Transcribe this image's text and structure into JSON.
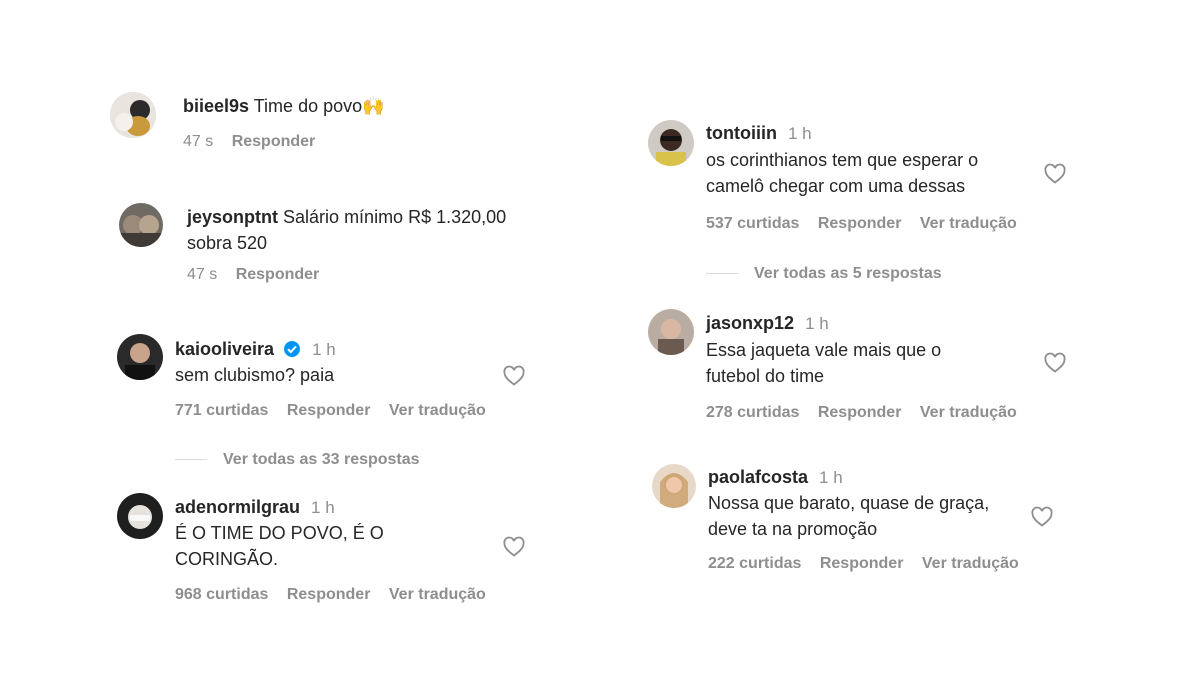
{
  "comments": [
    {
      "username": "biieel9s",
      "text": "Time do povo🙌",
      "time": "",
      "age": "47 s",
      "reply": "Responder",
      "likes": "",
      "translate": ""
    },
    {
      "username": "jeysonptnt",
      "text": "Salário mínimo R$ 1.320,00",
      "text2": "sobra 520",
      "time": "",
      "age": "47 s",
      "reply": "Responder"
    },
    {
      "username": "kaiooliveira",
      "verified": true,
      "time": "1 h",
      "text": "sem clubismo? paia",
      "likes": "771 curtidas",
      "reply": "Responder",
      "translate": "Ver tradução",
      "view_replies": "Ver todas as 33 respostas"
    },
    {
      "username": "adenormilgrau",
      "time": "1 h",
      "text": "É O TIME DO POVO, É O",
      "text2": "CORINGÃO.",
      "likes": "968 curtidas",
      "reply": "Responder",
      "translate": "Ver tradução"
    },
    {
      "username": "tontoiiin",
      "time": "1 h",
      "text": "os corinthianos tem que esperar o",
      "text2": "camelô chegar com uma dessas",
      "likes": "537 curtidas",
      "reply": "Responder",
      "translate": "Ver tradução",
      "view_replies": "Ver todas as 5 respostas"
    },
    {
      "username": "jasonxp12",
      "time": "1 h",
      "text": "Essa jaqueta vale mais que o",
      "text2": "futebol do time",
      "likes": "278 curtidas",
      "reply": "Responder",
      "translate": "Ver tradução"
    },
    {
      "username": "paolafcosta",
      "time": "1 h",
      "text": "Nossa que barato, quase de graça,",
      "text2": "deve ta na promoção",
      "likes": "222 curtidas",
      "reply": "Responder",
      "translate": "Ver tradução"
    }
  ],
  "colors": {
    "text": "#262626",
    "muted": "#8e8e8e",
    "verified": "#0095f6",
    "divider": "#dbdbdb"
  },
  "icons": {
    "heart": "heart-icon",
    "verified": "verified-badge-icon"
  }
}
